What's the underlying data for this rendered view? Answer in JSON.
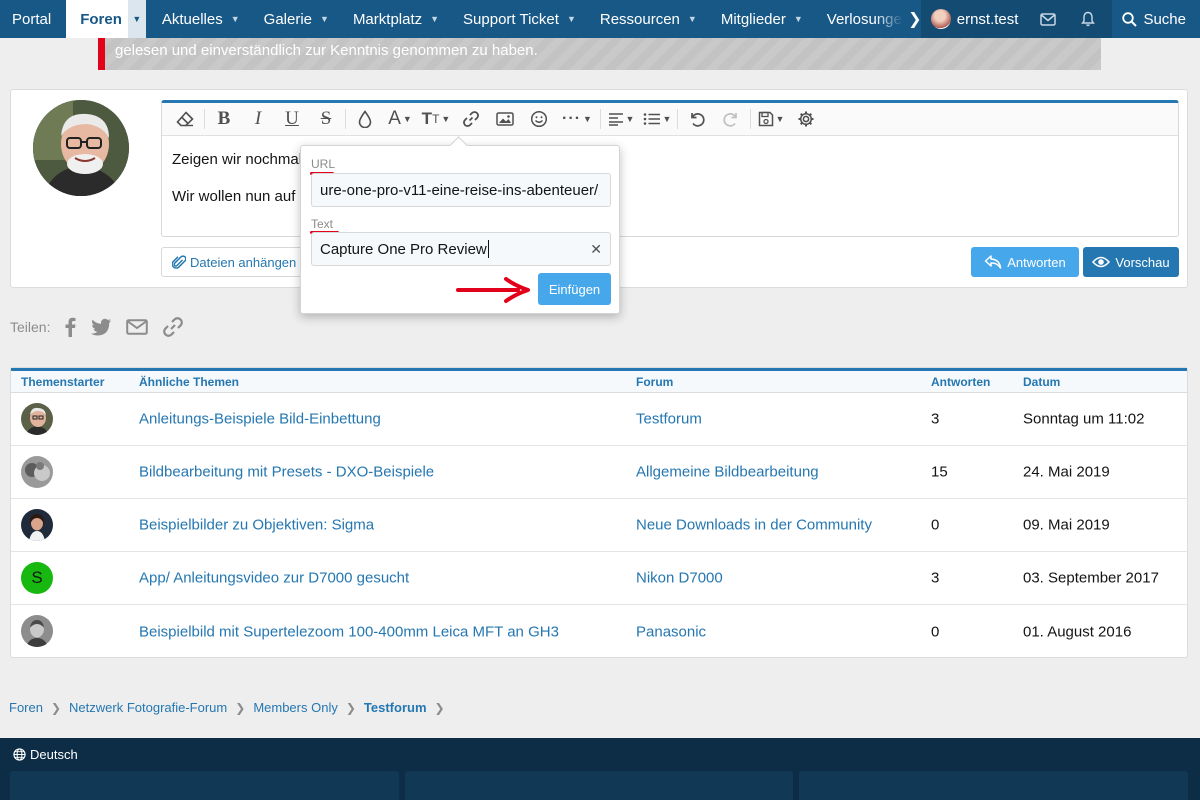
{
  "nav": {
    "items": [
      {
        "label": "Portal"
      },
      {
        "label": "Foren"
      },
      {
        "label": "Aktuelles"
      },
      {
        "label": "Galerie"
      },
      {
        "label": "Marktplatz"
      },
      {
        "label": "Support Ticket"
      },
      {
        "label": "Ressourcen"
      },
      {
        "label": "Mitglieder"
      },
      {
        "label": "Verlosungen"
      }
    ],
    "user": "ernst.test",
    "search": "Suche"
  },
  "notice": {
    "text": "gelesen und einverständlich zur Kenntnis genommen zu haben."
  },
  "editor": {
    "line1": "Zeigen wir nochmal",
    "line2": "Wir wollen nun auf",
    "attach": "Dateien anhängen",
    "reply": "Antworten",
    "preview": "Vorschau"
  },
  "link_popup": {
    "url_label": "URL",
    "url_value": "ure-one-pro-v11-eine-reise-ins-abenteuer/",
    "text_label": "Text",
    "text_value": "Capture One Pro Review",
    "insert": "Einfügen"
  },
  "share": {
    "label": "Teilen:"
  },
  "similar": {
    "headers": [
      "Themenstarter",
      "Ähnliche Themen",
      "Forum",
      "Antworten",
      "Datum"
    ],
    "rows": [
      {
        "title": "Anleitungs-Beispiele Bild-Einbettung",
        "forum": "Testforum",
        "replies": "3",
        "date": "Sonntag um 11:02"
      },
      {
        "title": "Bildbearbeitung mit Presets - DXO-Beispiele",
        "forum": "Allgemeine Bildbearbeitung",
        "replies": "15",
        "date": "24. Mai 2019"
      },
      {
        "title": "Beispielbilder zu Objektiven: Sigma",
        "forum": "Neue Downloads in der Community",
        "replies": "0",
        "date": "09. Mai 2019"
      },
      {
        "title": "App/ Anleitungsvideo zur D7000 gesucht",
        "forum": "Nikon D7000",
        "replies": "3",
        "date": "03. September 2017",
        "avatar_letter": "S"
      },
      {
        "title": "Beispielbild mit Supertelezoom 100-400mm Leica MFT an GH3",
        "forum": "Panasonic",
        "replies": "0",
        "date": "01. August 2016"
      }
    ]
  },
  "breadcrumb": [
    "Foren",
    "Netzwerk Fotografie-Forum",
    "Members Only",
    "Testforum"
  ],
  "footer": {
    "language": "Deutsch"
  },
  "colors": {
    "nav": "#185886",
    "accent": "#2577b1",
    "button": "#47a7eb",
    "footer": "#0d2d46",
    "marker": "#e3001b"
  }
}
